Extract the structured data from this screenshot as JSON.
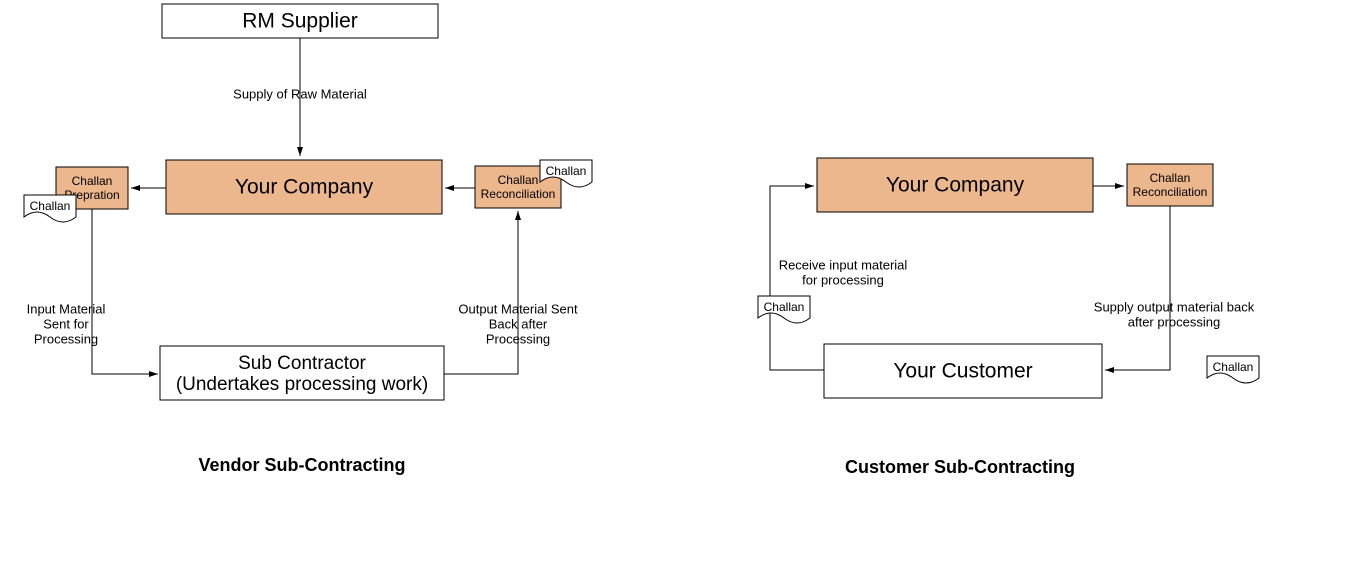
{
  "left": {
    "title": "Vendor Sub-Contracting",
    "rmSupplier": "RM  Supplier",
    "yourCompany": "Your Company",
    "challanPrep1": "Challan",
    "challanPrep2": "Prepration",
    "challanRecon1": "Challan",
    "challanRecon2": "Reconciliation",
    "subContractor1": "Sub Contractor",
    "subContractor2": "(Undertakes processing work)",
    "supplyRaw": "Supply of Raw Material",
    "inputMat1": "Input Material",
    "inputMat2": "Sent for",
    "inputMat3": "Processing",
    "outputMat1": "Output Material Sent",
    "outputMat2": "Back after",
    "outputMat3": "Processing",
    "docChallan": "Challan"
  },
  "right": {
    "title": "Customer Sub-Contracting",
    "yourCompany": "Your Company",
    "challanRecon1": "Challan",
    "challanRecon2": "Reconciliation",
    "yourCustomer": "Your Customer",
    "receive1": "Receive input material",
    "receive2": "for processing",
    "supply1": "Supply output material back",
    "supply2": "after processing",
    "docChallan": "Challan"
  }
}
